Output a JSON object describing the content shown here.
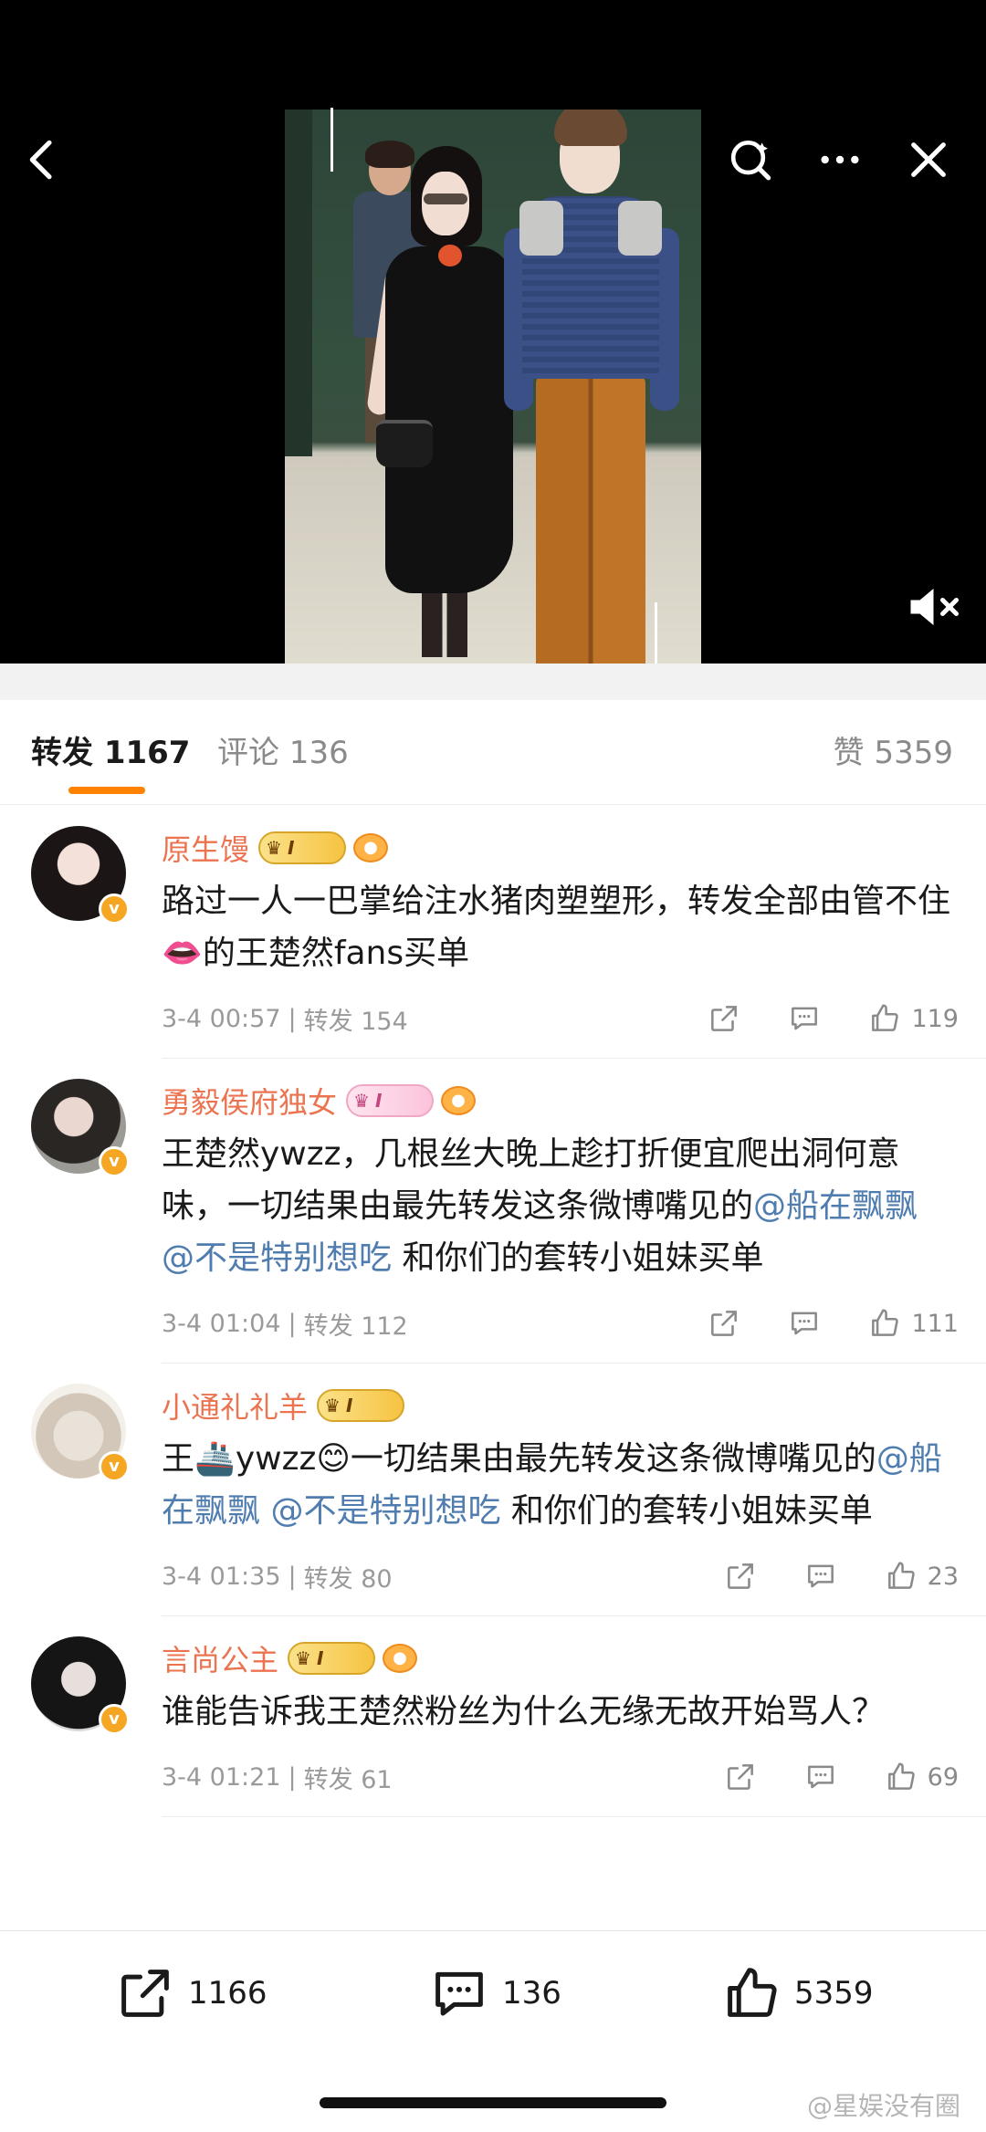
{
  "tabs": {
    "repost_label": "转发 1167",
    "comments_label": "评论 136",
    "likes_label": "赞 5359"
  },
  "items": [
    {
      "username": "原生馒",
      "badge": "I",
      "text": "路过一人一巴掌给注水猪肉塑塑形，转发全部由管不住👄的王楚然fans买单",
      "time": "3-4 00:57",
      "repost": "转发 154",
      "likes": "119"
    },
    {
      "username": "勇毅侯府独女",
      "badge": "I",
      "text_1": "王楚然ywzz，几根丝大晚上趁打折便宜爬出洞何意味，一切结果由最先转发这条微博嘴见的",
      "mention_1": "@船在飘飘",
      "mention_2": "@不是特别想吃",
      "text_2": " 和你们的套转小姐妹买单",
      "time": "3-4 01:04",
      "repost": "转发 112",
      "likes": "111"
    },
    {
      "username": "小通礼礼羊",
      "badge": "I",
      "text_1": "王🚢ywzz😊一切结果由最先转发这条微博嘴见的",
      "mention_1": "@船在飘飘",
      "mention_2": "@不是特别想吃",
      "text_2": " 和你们的套转小姐妹买单",
      "time": "3-4 01:35",
      "repost": "转发 80",
      "likes": "23"
    },
    {
      "username": "言尚公主",
      "badge": "I",
      "text": "谁能告诉我王楚然粉丝为什么无缘无故开始骂人？",
      "time": "3-4 01:21",
      "repost": "转发 61",
      "likes": "69"
    }
  ],
  "bottom_bar": {
    "repost_count": "1166",
    "comment_count": "136",
    "like_count": "5359"
  },
  "watermark": "@星娱没有圈"
}
